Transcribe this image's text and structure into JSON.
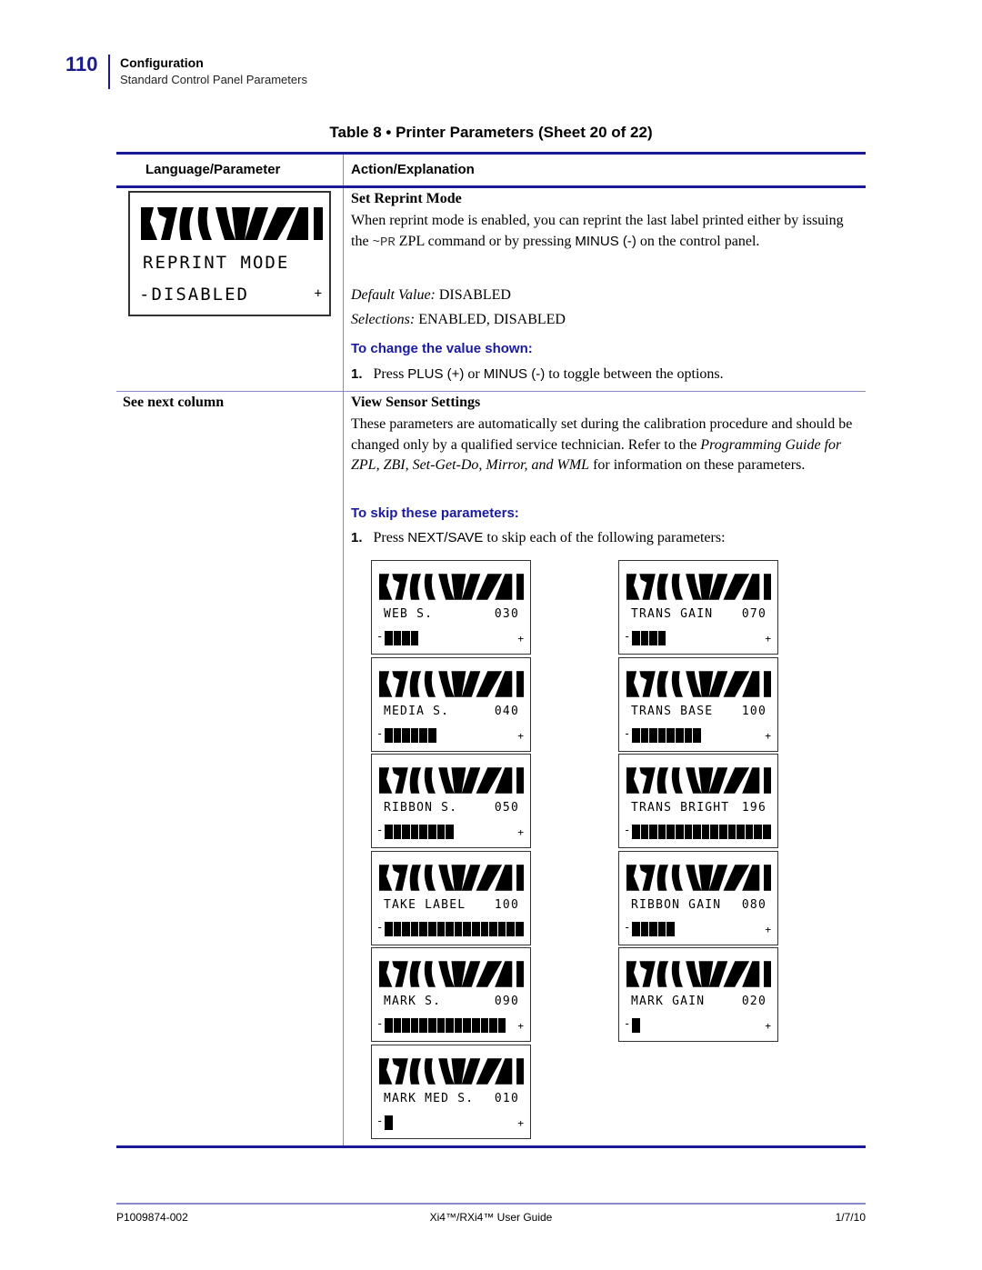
{
  "page": {
    "number": "110",
    "section": "Configuration",
    "subsection": "Standard Control Panel Parameters"
  },
  "table": {
    "caption": "Table 8 • Printer Parameters (Sheet 20 of 22)",
    "headers": [
      "Language/Parameter",
      "Action/Explanation"
    ],
    "rows": [
      {
        "display": {
          "line1": "REPRINT MODE",
          "line2": "-DISABLED",
          "plus": "+"
        },
        "title": "Set Reprint Mode",
        "desc_part1": "When reprint mode is enabled, you can reprint the last label printed either by issuing the ",
        "desc_code": "~PR",
        "desc_part2": " ZPL command or by pressing ",
        "desc_minus": "MINUS (-)",
        "desc_part3": " on the control panel.",
        "default_label": "Default Value:",
        "default_value": "DISABLED",
        "selections_label": "Selections:",
        "selections_value": "ENABLED, DISABLED",
        "procedure_heading": "To change the value shown:",
        "step_num": "1.",
        "step_pre": "Press ",
        "step_plus": "PLUS (+)",
        "step_mid": " or ",
        "step_minus": "MINUS (-)",
        "step_post": " to toggle between the options."
      },
      {
        "param": "See next column",
        "title": "View Sensor Settings",
        "desc_part1": "These parameters are automatically set during the calibration procedure and should be changed only by a qualified service technician. Refer to the ",
        "desc_italic": "Programming Guide for ZPL, ZBI, Set-Get-Do, Mirror, and WML",
        "desc_part2": " for information on these parameters.",
        "procedure_heading": "To skip these parameters:",
        "step_num": "1.",
        "step_pre": "Press ",
        "step_key": "NEXT/SAVE",
        "step_post": " to skip each of the following parameters:",
        "displays_left": [
          {
            "name": "WEB S.",
            "value": "030",
            "level_segments": 4,
            "show_plus": true
          },
          {
            "name": "MEDIA S.",
            "value": "040",
            "level_segments": 6,
            "show_plus": true
          },
          {
            "name": "RIBBON S.",
            "value": "050",
            "level_segments": 8,
            "show_plus": true
          },
          {
            "name": "TAKE LABEL",
            "value": "100",
            "level_segments": 16,
            "show_plus": false
          },
          {
            "name": "MARK S.",
            "value": "090",
            "level_segments": 14,
            "show_plus": true
          },
          {
            "name": "MARK MED S.",
            "value": "010",
            "level_segments": 1,
            "show_plus": true
          }
        ],
        "displays_right": [
          {
            "name": "TRANS GAIN",
            "value": "070",
            "level_segments": 4,
            "show_plus": true
          },
          {
            "name": "TRANS BASE",
            "value": "100",
            "level_segments": 8,
            "show_plus": true
          },
          {
            "name": "TRANS BRIGHT",
            "value": "196",
            "level_segments": 16,
            "show_plus": false
          },
          {
            "name": "RIBBON GAIN",
            "value": "080",
            "level_segments": 5,
            "show_plus": true
          },
          {
            "name": "MARK GAIN",
            "value": "020",
            "level_segments": 1,
            "show_plus": true
          }
        ],
        "display_minus": "-",
        "display_plus": "+"
      }
    ]
  },
  "footer": {
    "left": "P1009874-002",
    "center": "Xi4™/RXi4™ User Guide",
    "right": "1/7/10"
  }
}
